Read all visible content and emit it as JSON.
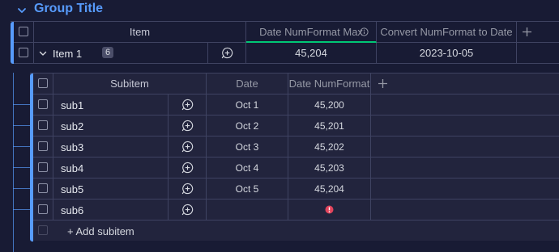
{
  "group": {
    "title": "Group Title",
    "color": "#579bfc"
  },
  "main_table": {
    "columns": {
      "item": "Item",
      "date_numformat_max": "Date NumFormat Max",
      "convert": "Convert NumFormat to Date"
    },
    "row": {
      "name": "Item 1",
      "subitem_count": "6",
      "date_numformat_max": "45,204",
      "converted_date": "2023-10-05"
    }
  },
  "subitems": {
    "columns": {
      "subitem": "Subitem",
      "date": "Date",
      "date_numformat": "Date NumFormat"
    },
    "rows": [
      {
        "name": "sub1",
        "date": "Oct 1",
        "numformat": "45,200"
      },
      {
        "name": "sub2",
        "date": "Oct 2",
        "numformat": "45,201"
      },
      {
        "name": "sub3",
        "date": "Oct 3",
        "numformat": "45,202"
      },
      {
        "name": "sub4",
        "date": "Oct 4",
        "numformat": "45,203"
      },
      {
        "name": "sub5",
        "date": "Oct 5",
        "numformat": "45,204"
      },
      {
        "name": "sub6",
        "date": "",
        "numformat": ""
      }
    ],
    "add_label": "+ Add subitem"
  },
  "colors": {
    "background": "#181b34",
    "accent": "#579bfc",
    "error": "#e2445c",
    "highlight": "#00c875"
  }
}
